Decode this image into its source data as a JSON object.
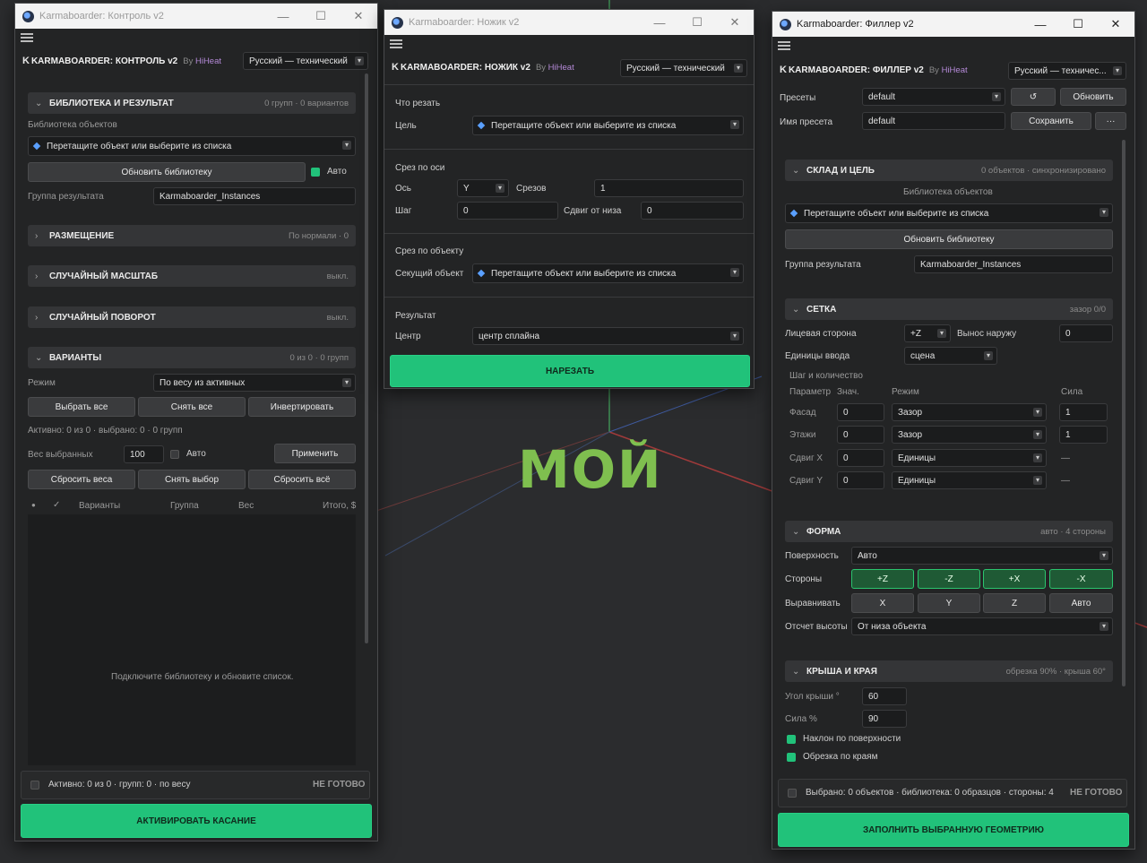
{
  "colors": {
    "accent": "#21c27a",
    "bg": "#232425",
    "field": "#1b1c1d"
  },
  "viewport": {
    "watermark": "МОЙ"
  },
  "control": {
    "window_title": "Karmaboarder: Контроль v2",
    "title": "KARMABOARDER: КОНТРОЛЬ v2",
    "by": "By",
    "author": "HiHeat",
    "lang": "Русский — технический",
    "library": {
      "title": "БИБЛИОТЕКА И РЕЗУЛЬТАТ",
      "meta": "0 групп · 0 вариантов",
      "lib_label": "Библиотека объектов",
      "pick": "Перетащите объект или выберите из списка",
      "refresh": "Обновить библиотеку",
      "auto": "Авто",
      "group_label": "Группа результата",
      "group_value": "Karmaboarder_Instances"
    },
    "placement": {
      "title": "РАЗМЕЩЕНИЕ",
      "meta": "По нормали · 0"
    },
    "scale": {
      "title": "СЛУЧАЙНЫЙ МАСШТАБ",
      "meta": "выкл."
    },
    "rotation": {
      "title": "СЛУЧАЙНЫЙ ПОВОРОТ",
      "meta": "выкл."
    },
    "variants": {
      "title": "ВАРИАНТЫ",
      "meta": "0 из 0 · 0 групп",
      "mode_label": "Режим",
      "mode_value": "По весу из активных",
      "select_all": "Выбрать все",
      "deselect_all": "Снять все",
      "invert": "Инвертировать",
      "active_line": "Активно: 0 из 0 · выбрано: 0 · 0 групп",
      "weight_label": "Вес выбранных",
      "weight_value": "100",
      "auto": "Авто",
      "apply": "Применить",
      "reset_weights": "Сбросить веса",
      "clear_sel": "Снять выбор",
      "reset_all": "Сбросить всё"
    },
    "table": {
      "dot": "●",
      "check": "✓",
      "col_variants": "Варианты",
      "col_group": "Группа",
      "col_weight": "Вес",
      "col_total": "Итого, $",
      "empty": "Подключите библиотеку и обновите список."
    },
    "status": "Активно: 0 из 0 · групп: 0 · по весу",
    "status_state": "НЕ ГОТОВО",
    "main_action": "АКТИВИРОВАТЬ КАСАНИЕ"
  },
  "knife": {
    "window_title": "Karmaboarder: Ножик v2",
    "title": "KARMABOARDER: НОЖИК v2",
    "by": "By",
    "author": "HiHeat",
    "lang": "Русский — технический",
    "what": "Что резать",
    "target_label": "Цель",
    "pick": "Перетащите объект или выберите из списка",
    "axis_section": "Срез по оси",
    "axis_label": "Ось",
    "axis_value": "Y",
    "slices_label": "Срезов",
    "slices_value": "1",
    "step_label": "Шаг",
    "step_value": "0",
    "shift_label": "Сдвиг от низа",
    "shift_value": "0",
    "obj_section": "Срез по объекту",
    "cutter_label": "Секущий объект",
    "result_section": "Результат",
    "center_label": "Центр",
    "center_value": "центр сплайна",
    "action": "НАРЕЗАТЬ"
  },
  "filler": {
    "window_title": "Karmaboarder: Филлер v2",
    "title": "KARMABOARDER: ФИЛЛЕР v2",
    "by": "By",
    "author": "HiHeat",
    "lang": "Русский — техничес...",
    "presets_label": "Пресеты",
    "presets_value": "default",
    "reload": "↺",
    "update": "Обновить",
    "preset_name_label": "Имя пресета",
    "preset_name_value": "default",
    "save": "Сохранить",
    "more": "···",
    "storage": {
      "title": "СКЛАД И ЦЕЛЬ",
      "meta": "0 объектов · синхронизировано",
      "lib_label": "Библиотека объектов",
      "pick": "Перетащите объект или выберите из списка",
      "refresh": "Обновить библиотеку",
      "group_label": "Группа результата",
      "group_value": "Karmaboarder_Instances"
    },
    "grid": {
      "title": "СЕТКА",
      "meta": "зазор 0/0",
      "face_label": "Лицевая сторона",
      "face_value": "+Z",
      "out_label": "Вынос наружу",
      "out_value": "0",
      "units_label": "Единицы ввода",
      "units_value": "сцена",
      "step_count": "Шаг и количество",
      "col_param": "Параметр",
      "col_val": "Знач.",
      "col_mode": "Режим",
      "col_force": "Сила",
      "rows": [
        {
          "name": "Фасад",
          "val": "0",
          "mode": "Зазор",
          "force": "1"
        },
        {
          "name": "Этажи",
          "val": "0",
          "mode": "Зазор",
          "force": "1"
        },
        {
          "name": "Сдвиг X",
          "val": "0",
          "mode": "Единицы",
          "force": "—"
        },
        {
          "name": "Сдвиг Y",
          "val": "0",
          "mode": "Единицы",
          "force": "—"
        }
      ]
    },
    "shape": {
      "title": "ФОРМА",
      "meta": "авто · 4 стороны",
      "surface_label": "Поверхность",
      "surface_value": "Авто",
      "sides_label": "Стороны",
      "sides": [
        "+Z",
        "-Z",
        "+X",
        "-X"
      ],
      "align_label": "Выравнивать",
      "align": [
        "X",
        "Y",
        "Z",
        "Авто"
      ],
      "height_label": "Отсчет высоты",
      "height_value": "От низа объекта"
    },
    "roof": {
      "title": "КРЫША И КРАЯ",
      "meta": "обрезка 90% · крыша 60°",
      "angle_label": "Угол крыши °",
      "angle_value": "60",
      "force_label": "Сила %",
      "force_value": "90",
      "tilt": "Наклон по поверхности",
      "trim": "Обрезка по краям"
    },
    "status": "Выбрано: 0 объектов · библиотека: 0 образцов · стороны: 4",
    "status_state": "НЕ ГОТОВО",
    "main_action": "ЗАПОЛНИТЬ ВЫБРАННУЮ ГЕОМЕТРИЮ"
  }
}
